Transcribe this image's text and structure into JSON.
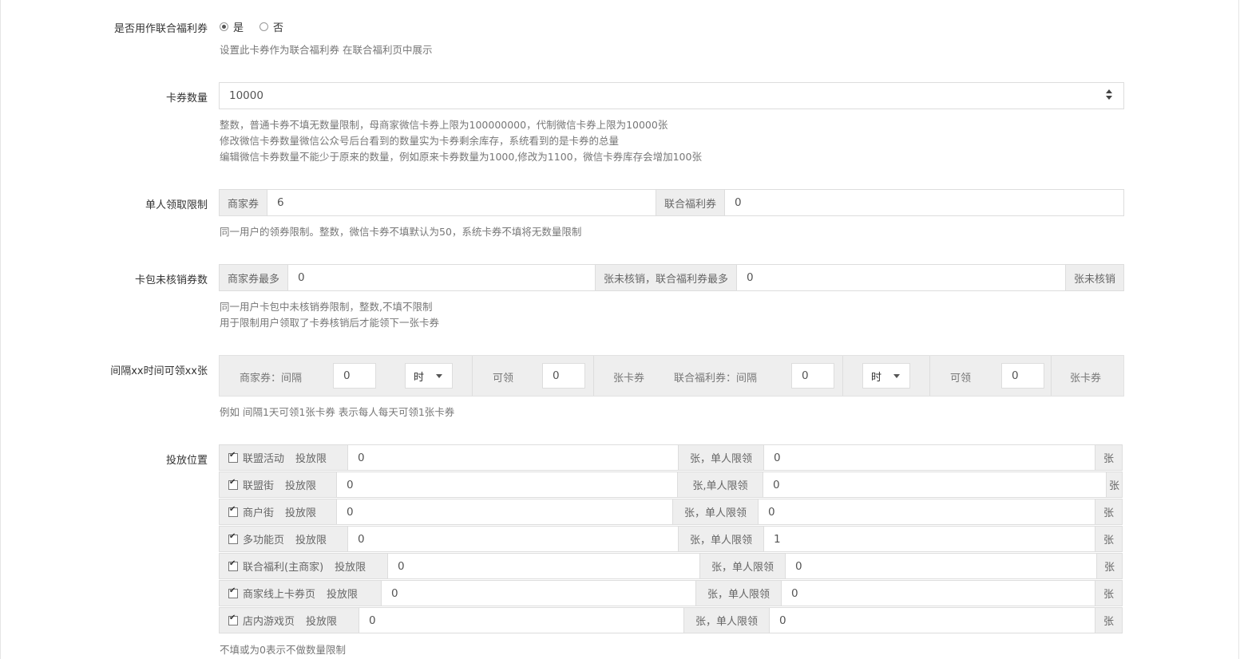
{
  "union": {
    "label": "是否用作联合福利券",
    "yes": "是",
    "no": "否",
    "selected": "yes",
    "help": "设置此卡券作为联合福利券 在联合福利页中展示"
  },
  "quantity": {
    "label": "卡券数量",
    "value": "10000",
    "help": [
      "整数，普通卡券不填无数量限制，母商家微信卡券上限为100000000，代制微信卡券上限为10000张",
      "修改微信卡券数量微信公众号后台看到的数量实为卡券剩余库存，系统看到的是卡券的总量",
      "编辑微信卡券数量不能少于原来的数量，例如原来卡券数量为1000,修改为1100，微信卡券库存会增加100张"
    ]
  },
  "per_user": {
    "label": "单人领取限制",
    "merchant_addon": "商家券",
    "merchant_value": "6",
    "union_addon": "联合福利券",
    "union_value": "0",
    "help": "同一用户的领券限制。整数，微信卡券不填默认为50，系统卡券不填将无数量限制"
  },
  "unused": {
    "label": "卡包未核销券数",
    "addon1": "商家券最多",
    "value1": "0",
    "addon2": "张未核销，联合福利券最多",
    "value2": "0",
    "addon3": "张未核销",
    "help": [
      "同一用户卡包中未核销券限制，整数,不填不限制",
      "用于限制用户领取了卡券核销后才能领下一张卡券"
    ]
  },
  "interval": {
    "label": "间隔xx时间可领xx张",
    "merchant_label": "商家券：间隔",
    "merchant_interval": "0",
    "merchant_unit": "时",
    "merchant_can": "可领",
    "merchant_count": "0",
    "merchant_suffix": "张卡券",
    "union_label": "联合福利券：间隔",
    "union_interval": "0",
    "union_unit": "时",
    "union_can": "可领",
    "union_count": "0",
    "union_suffix": "张卡券",
    "help": "例如 间隔1天可领1张卡券 表示每人每天可领1张卡券"
  },
  "placement": {
    "label": "投放位置",
    "rows": [
      {
        "name": "联盟活动",
        "limit_label": "投放限",
        "limit": "0",
        "per_label": "张，单人限领",
        "per": "0",
        "unit": "张",
        "checked": true
      },
      {
        "name": "联盟街",
        "limit_label": "投放限",
        "limit": "0",
        "per_label": "张,单人限领",
        "per": "0",
        "unit": "张",
        "checked": true
      },
      {
        "name": "商户街",
        "limit_label": "投放限",
        "limit": "0",
        "per_label": "张，单人限领",
        "per": "0",
        "unit": "张",
        "checked": true
      },
      {
        "name": "多功能页",
        "limit_label": "投放限",
        "limit": "0",
        "per_label": "张，单人限领",
        "per": "1",
        "unit": "张",
        "checked": true
      },
      {
        "name": "联合福利(主商家)",
        "limit_label": "投放限",
        "limit": "0",
        "per_label": "张，单人限领",
        "per": "0",
        "unit": "张",
        "checked": true
      },
      {
        "name": "商家线上卡券页",
        "limit_label": "投放限",
        "limit": "0",
        "per_label": "张，单人限领",
        "per": "0",
        "unit": "张",
        "checked": true
      },
      {
        "name": "店内游戏页",
        "limit_label": "投放限",
        "limit": "0",
        "per_label": "张，单人限领",
        "per": "0",
        "unit": "张",
        "checked": true
      }
    ],
    "help": "不填或为0表示不做数量限制"
  }
}
